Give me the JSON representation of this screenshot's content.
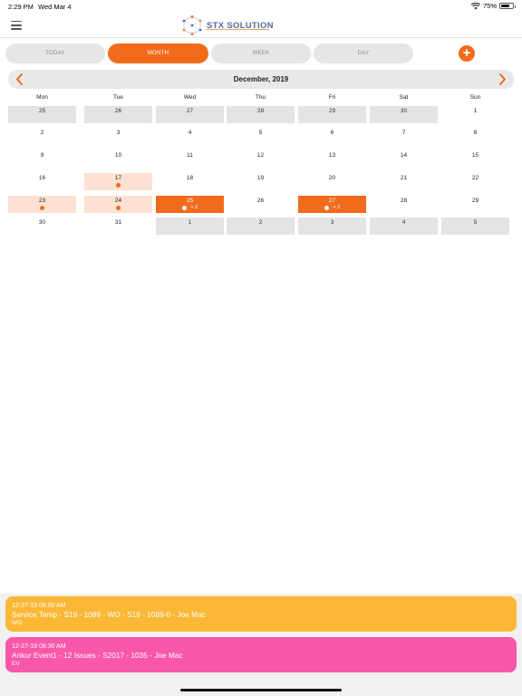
{
  "status_bar": {
    "time": "2:29 PM",
    "date": "Wed Mar 4",
    "battery": "75%",
    "battery_level": 0.75
  },
  "header": {
    "logo_text": "STX SOLUTION"
  },
  "tabs": [
    {
      "label": "TODAY",
      "active": false
    },
    {
      "label": "MONTH",
      "active": true
    },
    {
      "label": "WEEK",
      "active": false
    },
    {
      "label": "DAY",
      "active": false
    }
  ],
  "add_label": "+",
  "calendar": {
    "month_title": "December, 2019",
    "weekdays": [
      "Mon",
      "Tue",
      "Wed",
      "Thu",
      "Fri",
      "Sat",
      "Sun"
    ],
    "weeks": [
      [
        {
          "day": "25",
          "type": "other"
        },
        {
          "day": "26",
          "type": "other"
        },
        {
          "day": "27",
          "type": "other"
        },
        {
          "day": "28",
          "type": "other"
        },
        {
          "day": "29",
          "type": "other"
        },
        {
          "day": "30",
          "type": "other"
        },
        {
          "day": "1",
          "type": "normal"
        }
      ],
      [
        {
          "day": "2",
          "type": "normal"
        },
        {
          "day": "3",
          "type": "normal"
        },
        {
          "day": "4",
          "type": "normal"
        },
        {
          "day": "5",
          "type": "normal"
        },
        {
          "day": "6",
          "type": "normal"
        },
        {
          "day": "7",
          "type": "normal"
        },
        {
          "day": "8",
          "type": "normal"
        }
      ],
      [
        {
          "day": "9",
          "type": "normal"
        },
        {
          "day": "10",
          "type": "normal"
        },
        {
          "day": "11",
          "type": "normal"
        },
        {
          "day": "12",
          "type": "normal"
        },
        {
          "day": "13",
          "type": "normal"
        },
        {
          "day": "14",
          "type": "normal"
        },
        {
          "day": "15",
          "type": "normal"
        }
      ],
      [
        {
          "day": "16",
          "type": "normal"
        },
        {
          "day": "17",
          "type": "event",
          "dots": 1
        },
        {
          "day": "18",
          "type": "normal"
        },
        {
          "day": "19",
          "type": "normal"
        },
        {
          "day": "20",
          "type": "normal"
        },
        {
          "day": "21",
          "type": "normal"
        },
        {
          "day": "22",
          "type": "normal"
        }
      ],
      [
        {
          "day": "23",
          "type": "event",
          "dots": 1
        },
        {
          "day": "24",
          "type": "event",
          "dots": 1
        },
        {
          "day": "25",
          "type": "selected",
          "dots": 1,
          "more": "+ 2"
        },
        {
          "day": "26",
          "type": "normal"
        },
        {
          "day": "27",
          "type": "selected",
          "dots": 1,
          "more": "+ 2"
        },
        {
          "day": "28",
          "type": "normal"
        },
        {
          "day": "29",
          "type": "normal"
        }
      ],
      [
        {
          "day": "30",
          "type": "normal"
        },
        {
          "day": "31",
          "type": "normal"
        },
        {
          "day": "1",
          "type": "other"
        },
        {
          "day": "2",
          "type": "other"
        },
        {
          "day": "3",
          "type": "other"
        },
        {
          "day": "4",
          "type": "other"
        },
        {
          "day": "5",
          "type": "other"
        }
      ]
    ]
  },
  "events": [
    {
      "time": "12-27-19 08:00 AM",
      "title": "Service Temp - S19  -  1089 - WO - S19  -  1089-0 - Joe Mac",
      "code": "WO",
      "color": "#fbb836"
    },
    {
      "time": "12-27-19 08:30 AM",
      "title": "Ankur Event1 - 12 Issues - S2017  -  1035 - Joe Mac",
      "code": "EV",
      "color": "#f957a9"
    }
  ],
  "colors": {
    "accent": "#f26b1d",
    "event_highlight": "#fde1d2",
    "other_month": "#e4e4e4"
  }
}
